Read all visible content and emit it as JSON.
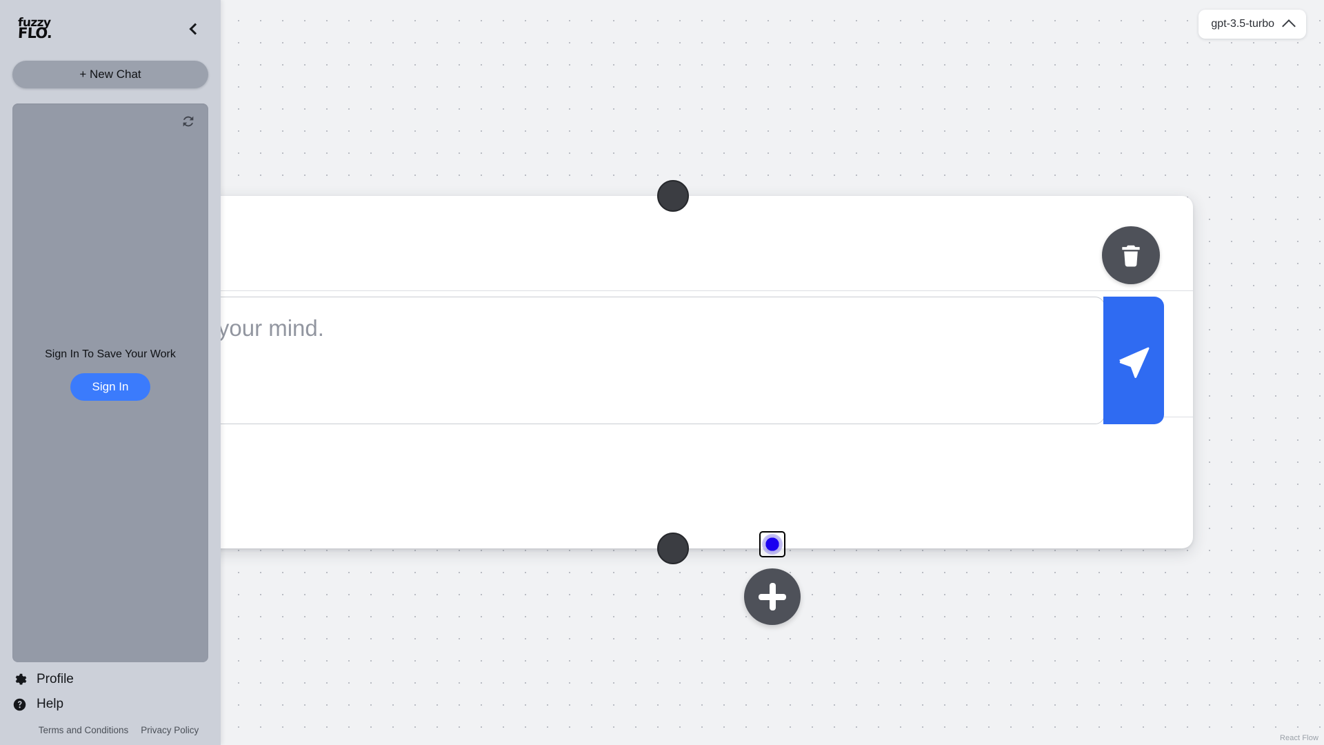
{
  "app": {
    "logo_line1": "fuzzy",
    "logo_line2": "FLO."
  },
  "sidebar": {
    "collapse_icon": "chevron-left-icon",
    "new_chat_label": "+ New Chat",
    "history": {
      "refresh_icon": "refresh-icon",
      "signin_prompt": "Sign In To Save Your Work",
      "signin_button": "Sign In"
    },
    "footer": {
      "items": [
        {
          "label": "Profile",
          "icon": "gear-icon"
        },
        {
          "label": "Help",
          "icon": "question-circle-icon"
        }
      ],
      "legal": [
        {
          "label": "Terms and Conditions"
        },
        {
          "label": "Privacy Policy"
        }
      ]
    }
  },
  "canvas": {
    "model_selector": {
      "value": "gpt-3.5-turbo",
      "chevron_icon": "chevron-up-icon"
    },
    "attribution": "React Flow",
    "add_node_button": {
      "icon": "plus-icon",
      "label": "+"
    },
    "node": {
      "delete_icon": "trash-icon",
      "send_icon": "send-paper-plane-icon",
      "prompt_value": "",
      "prompt_placeholder": "What's on your mind.",
      "handle_top": "connection-handle",
      "handle_bottom": "connection-handle"
    }
  },
  "colors": {
    "accent_blue": "#2f6bf2",
    "signin_blue": "#3b7bfc",
    "dark_button": "#4e5159",
    "sidebar_bg": "#ccd0d9",
    "history_bg": "#949aa7",
    "canvas_bg": "#f1f2f4"
  }
}
